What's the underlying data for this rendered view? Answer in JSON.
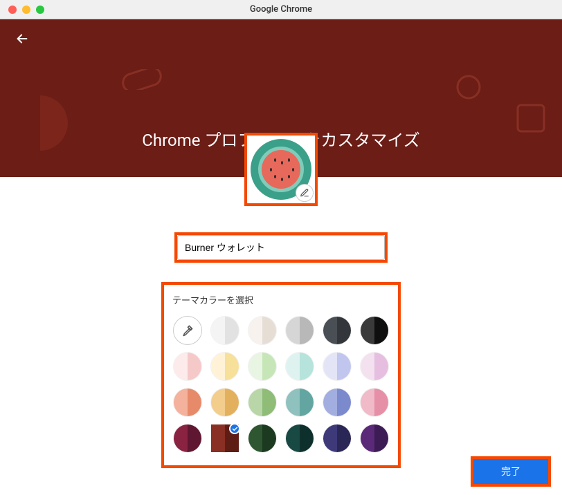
{
  "window": {
    "title": "Google Chrome"
  },
  "hero": {
    "title": "Chrome プロファイルをカスタマイズ"
  },
  "profile": {
    "name": "Burner ウォレット"
  },
  "theme": {
    "label": "テーマカラーを選択",
    "selected_index": 19,
    "swatches": [
      {
        "type": "picker"
      },
      {
        "l": "#f4f4f4",
        "r": "#e2e2e2"
      },
      {
        "l": "#f7f2ee",
        "r": "#e6ded5"
      },
      {
        "l": "#d6d6d6",
        "r": "#b8b8b8"
      },
      {
        "l": "#4a4f55",
        "r": "#33373c"
      },
      {
        "l": "#3a3a3a",
        "r": "#0f0f0f"
      },
      {
        "l": "#fdeaea",
        "r": "#f6c9c9"
      },
      {
        "l": "#fff2d6",
        "r": "#f6e09a"
      },
      {
        "l": "#e8f5e3",
        "r": "#c6e6b8"
      },
      {
        "l": "#def3f0",
        "r": "#b6e3db"
      },
      {
        "l": "#e3e5f7",
        "r": "#c1c6ee"
      },
      {
        "l": "#f4e1f0",
        "r": "#e6bfe0"
      },
      {
        "l": "#f4b19c",
        "r": "#e68a6a"
      },
      {
        "l": "#f2cd8c",
        "r": "#e3b15d"
      },
      {
        "l": "#b8d6a7",
        "r": "#8fbd78"
      },
      {
        "l": "#8fc1be",
        "r": "#63a6a1"
      },
      {
        "l": "#a3aee0",
        "r": "#7b8acd"
      },
      {
        "l": "#f1bac8",
        "r": "#e690a7"
      },
      {
        "l": "#8a2242",
        "r": "#5f1630"
      },
      {
        "l": "#8a2f23",
        "r": "#5d1d15"
      },
      {
        "l": "#2e5630",
        "r": "#1c3a1f"
      },
      {
        "l": "#184943",
        "r": "#0e302c"
      },
      {
        "l": "#3e3a7a",
        "r": "#2a2656"
      },
      {
        "l": "#5a2a78",
        "r": "#3d1c55"
      }
    ]
  },
  "actions": {
    "done": "完了"
  }
}
